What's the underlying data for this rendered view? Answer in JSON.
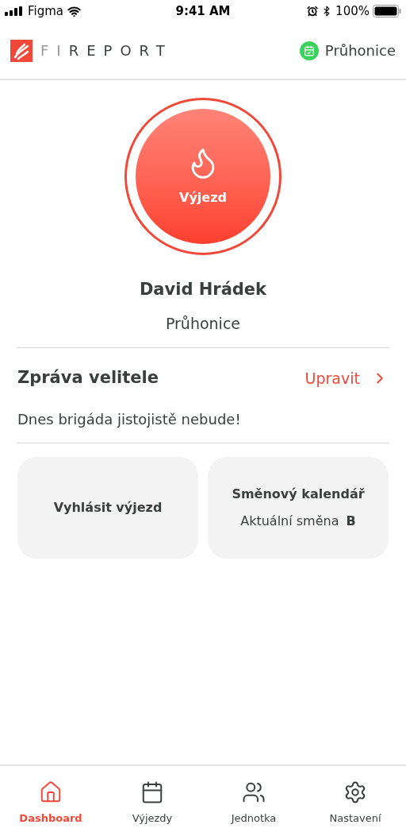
{
  "status_bar": {
    "carrier": "Figma",
    "time": "9:41 AM",
    "battery": "100%"
  },
  "header": {
    "logo_light": "FI",
    "logo_dark": "REPORT",
    "station": "Průhonice"
  },
  "dispatch_button": {
    "label": "Výjezd"
  },
  "profile": {
    "name": "David Hrádek",
    "station": "Průhonice"
  },
  "commander_message": {
    "title": "Zpráva velitele",
    "action": "Upravit",
    "text": "Dnes brigáda jistojistě nebude!"
  },
  "cards": [
    {
      "kind": "action",
      "title": "Vyhlásit výjezd"
    },
    {
      "kind": "shift",
      "title": "Směnový kalendář",
      "subtitle": "Aktuální směna",
      "shift": "B"
    }
  ],
  "tabs": [
    {
      "kind": "home",
      "label": "Dashboard",
      "selected": true
    },
    {
      "kind": "calendar",
      "label": "Výjezdy",
      "selected": false
    },
    {
      "kind": "people",
      "label": "Jednotka",
      "selected": false
    },
    {
      "kind": "gear",
      "label": "Nastavení",
      "selected": false
    }
  ]
}
